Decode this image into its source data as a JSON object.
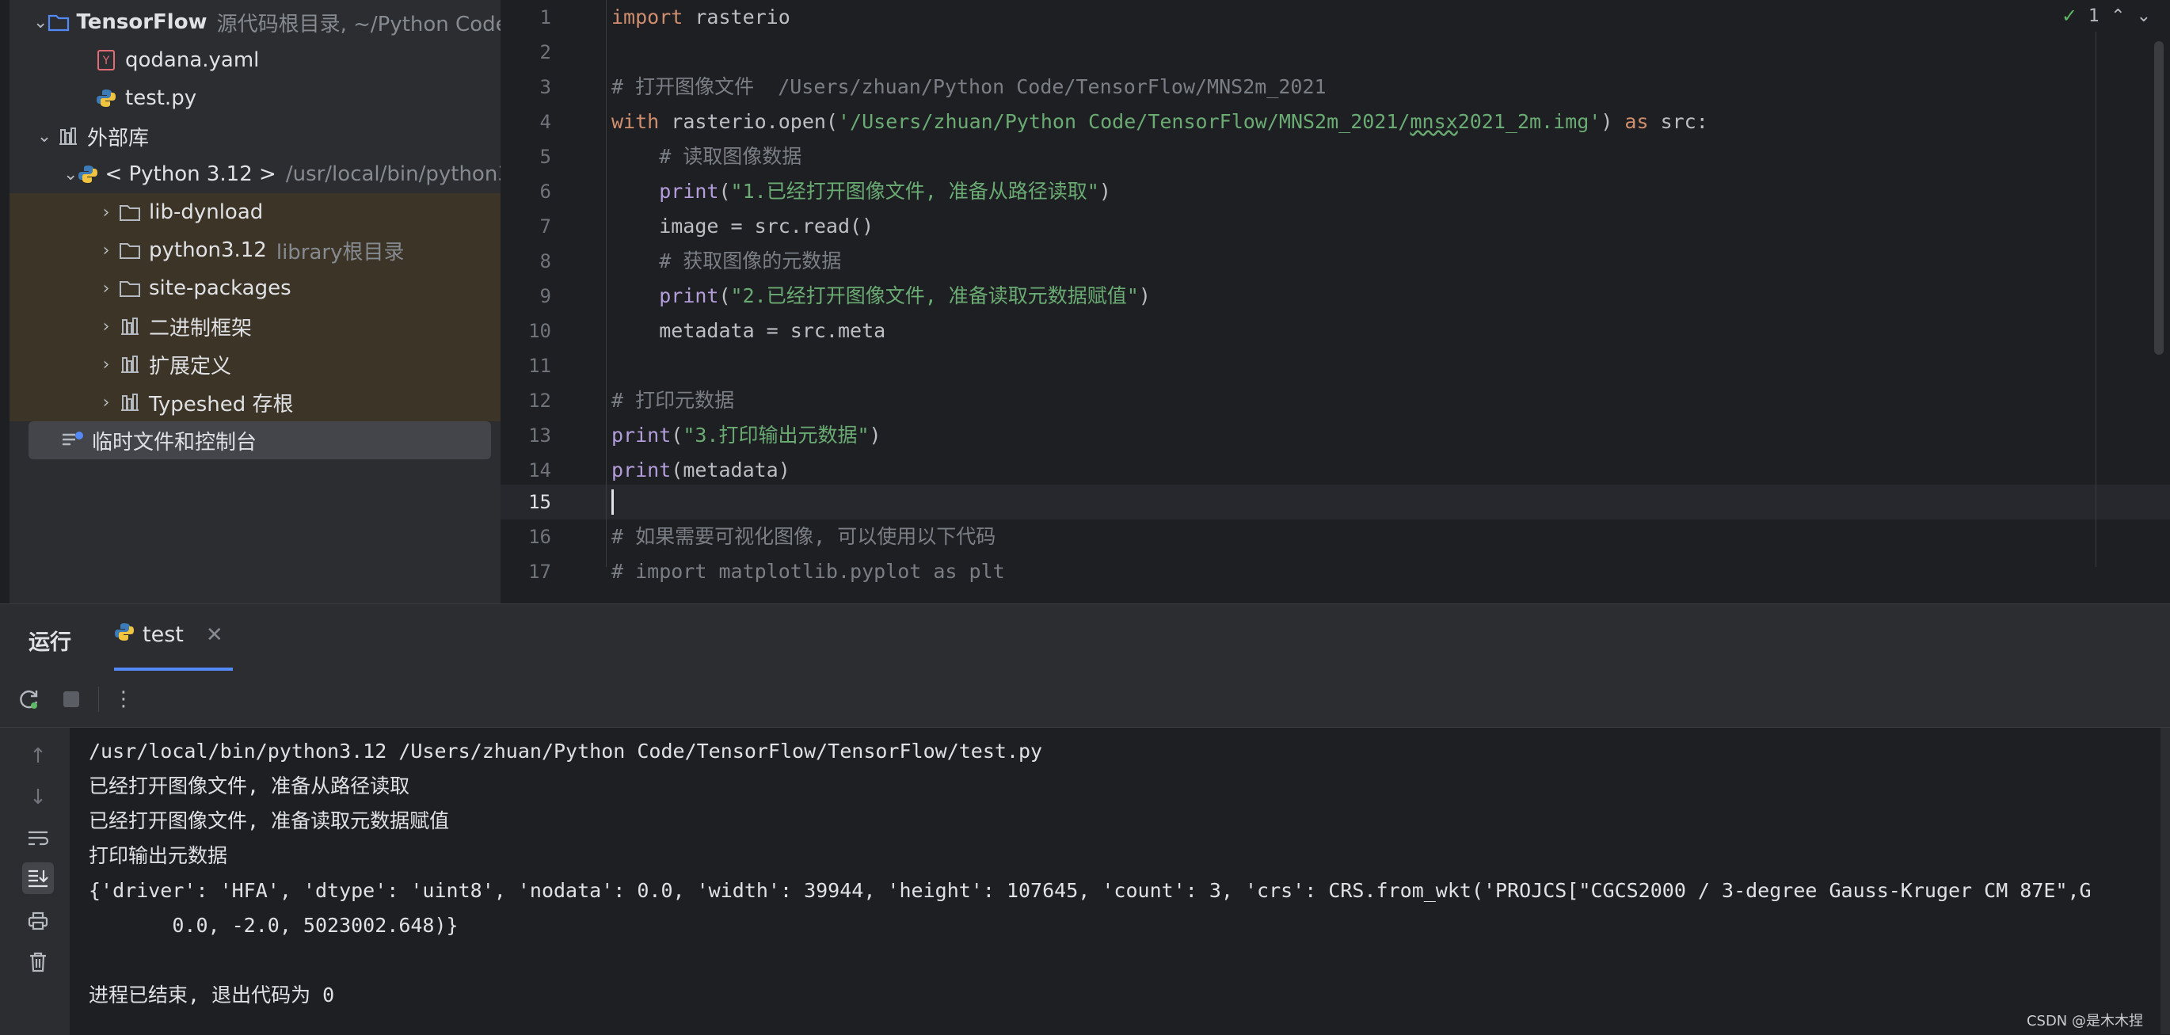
{
  "project_tree": {
    "root_name": "TensorFlow",
    "root_hint": "源代码根目录, ~/Python Code",
    "file_yaml": "qodana.yaml",
    "file_py": "test.py",
    "external_libs": "外部库",
    "python_sdk": "< Python 3.12 >",
    "python_sdk_path": "/usr/local/bin/python3",
    "lib_dynload": "lib-dynload",
    "python312": "python3.12",
    "python312_hint": "library根目录",
    "site_packages": "site-packages",
    "binary_skeletons": "二进制框架",
    "extended_defs": "扩展定义",
    "typeshed": "Typeshed 存根",
    "scratches": "临时文件和控制台"
  },
  "editor": {
    "inspection_count": "1",
    "line_numbers": [
      "1",
      "2",
      "3",
      "4",
      "5",
      "6",
      "7",
      "8",
      "9",
      "10",
      "11",
      "12",
      "13",
      "14",
      "15",
      "16",
      "17"
    ],
    "current_line": "15",
    "lines": {
      "l1_kw": "import",
      "l1_rest": " rasterio",
      "l3": "# 打开图像文件  /Users/zhuan/Python Code/TensorFlow/MNS2m_2021",
      "l4_kw": "with",
      "l4_a": " rasterio.open(",
      "l4_str_a": "'/Users/zhuan/Python Code/TensorFlow/MNS2m_2021/",
      "l4_str_b": "mnsx",
      "l4_str_c": "2021_2m.img'",
      "l4_b": ") ",
      "l4_kw2": "as",
      "l4_c": " src:",
      "l5": "    # 读取图像数据",
      "l6_fn": "print",
      "l6_str": "\"1.已经打开图像文件, 准备从路径读取\"",
      "l7": "    image = src.read()",
      "l8": "    # 获取图像的元数据",
      "l9_fn": "print",
      "l9_str": "\"2.已经打开图像文件, 准备读取元数据赋值\"",
      "l10": "    metadata = src.meta",
      "l12": "# 打印元数据",
      "l13_fn": "print",
      "l13_str": "\"3.打印输出元数据\"",
      "l14_fn": "print",
      "l14_rest": "(metadata)",
      "l16": "# 如果需要可视化图像, 可以使用以下代码",
      "l17": "# import matplotlib.pyplot as plt"
    }
  },
  "run_panel": {
    "title": "运行",
    "tab_label": "test",
    "output": [
      "/usr/local/bin/python3.12 /Users/zhuan/Python Code/TensorFlow/TensorFlow/test.py",
      "已经打开图像文件, 准备从路径读取",
      "已经打开图像文件, 准备读取元数据赋值",
      "打印输出元数据",
      "{'driver': 'HFA', 'dtype': 'uint8', 'nodata': 0.0, 'width': 39944, 'height': 107645, 'count': 3, 'crs': CRS.from_wkt('PROJCS[\"CGCS2000 / 3-degree Gauss-Kruger CM 87E\",G",
      "       0.0, -2.0, 5023002.648)}",
      "",
      "进程已结束, 退出代码为 0"
    ]
  },
  "watermark": "CSDN @是木木捏",
  "colors": {
    "keyword": "#cf8e6d",
    "function": "#b39ddb",
    "string": "#6aab73",
    "comment": "#7a7e85",
    "library_highlight": "#3c3426"
  }
}
